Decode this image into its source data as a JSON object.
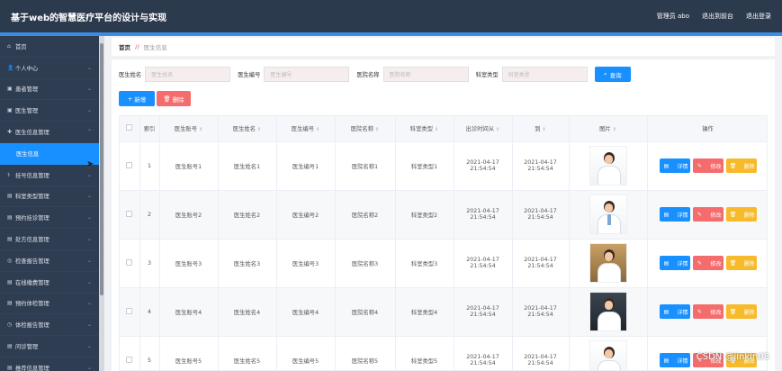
{
  "header": {
    "title": "基于web的智慧医疗平台的设计与实现",
    "admin_label": "管理员 abo",
    "back_label": "退出到前台",
    "logout_label": "退出登录"
  },
  "sidebar": {
    "items": [
      {
        "icon": "⌂",
        "label": "首页"
      },
      {
        "icon": "👤",
        "label": "个人中心"
      },
      {
        "icon": "▣",
        "label": "患者管理"
      },
      {
        "icon": "▣",
        "label": "医生管理"
      },
      {
        "icon": "✚",
        "label": "医生信息管理"
      },
      {
        "icon": "",
        "label": "医生信息"
      },
      {
        "icon": "⚕",
        "label": "挂号信息管理"
      },
      {
        "icon": "▤",
        "label": "科室类型管理"
      },
      {
        "icon": "▤",
        "label": "预约挂诊管理"
      },
      {
        "icon": "▤",
        "label": "处方信息管理"
      },
      {
        "icon": "◎",
        "label": "检查报告管理"
      },
      {
        "icon": "▤",
        "label": "在线缴费管理"
      },
      {
        "icon": "▤",
        "label": "预约体检管理"
      },
      {
        "icon": "◷",
        "label": "体检报告管理"
      },
      {
        "icon": "▤",
        "label": "问诊管理"
      },
      {
        "icon": "▤",
        "label": "推荐信息管理"
      }
    ]
  },
  "breadcrumb": {
    "home": "首页",
    "separator": "//",
    "current": "医生信息"
  },
  "filters": {
    "name_label": "医生姓名",
    "name_placeholder": "医生姓名",
    "code_label": "医生编号",
    "code_placeholder": "医生编号",
    "hospital_label": "医院名称",
    "hospital_placeholder": "医院名称",
    "dept_label": "科室类型",
    "dept_placeholder": "科室类型",
    "search_label": "查询"
  },
  "actions": {
    "add_label": "新增",
    "delete_label": "删除"
  },
  "table": {
    "columns": {
      "index": "索引",
      "account": "医生账号",
      "name": "医生姓名",
      "code": "医生编号",
      "hospital": "医院名称",
      "dept": "科室类型",
      "start": "出诊时间从",
      "end": "到",
      "photo": "图片",
      "ops": "操作"
    },
    "ops": {
      "detail": "详情",
      "edit": "修改",
      "delete": "删除"
    },
    "rows": [
      {
        "index": "1",
        "account": "医生账号1",
        "name": "医生姓名1",
        "code": "医生编号1",
        "hospital": "医院名称1",
        "dept": "科室类型1",
        "start": "2021-04-17 21:54:54",
        "end": "2021-04-17 21:54:54"
      },
      {
        "index": "2",
        "account": "医生账号2",
        "name": "医生姓名2",
        "code": "医生编号2",
        "hospital": "医院名称2",
        "dept": "科室类型2",
        "start": "2021-04-17 21:54:54",
        "end": "2021-04-17 21:54:54"
      },
      {
        "index": "3",
        "account": "医生账号3",
        "name": "医生姓名3",
        "code": "医生编号3",
        "hospital": "医院名称3",
        "dept": "科室类型3",
        "start": "2021-04-17 21:54:54",
        "end": "2021-04-17 21:54:54"
      },
      {
        "index": "4",
        "account": "医生账号4",
        "name": "医生姓名4",
        "code": "医生编号4",
        "hospital": "医院名称4",
        "dept": "科室类型4",
        "start": "2021-04-17 21:54:54",
        "end": "2021-04-17 21:54:54"
      },
      {
        "index": "5",
        "account": "医生账号5",
        "name": "医生姓名5",
        "code": "医生编号5",
        "hospital": "医院名称5",
        "dept": "科室类型5",
        "start": "2021-04-17 21:54:54",
        "end": "2021-04-17 21:54:54"
      }
    ]
  },
  "watermark": "CSDN @jinkin05",
  "colors": {
    "primary": "#1890ff",
    "danger": "#f56c6c",
    "warning": "#f7ba2a",
    "header": "#2c3a4e",
    "sidebar": "#2f3d52"
  }
}
